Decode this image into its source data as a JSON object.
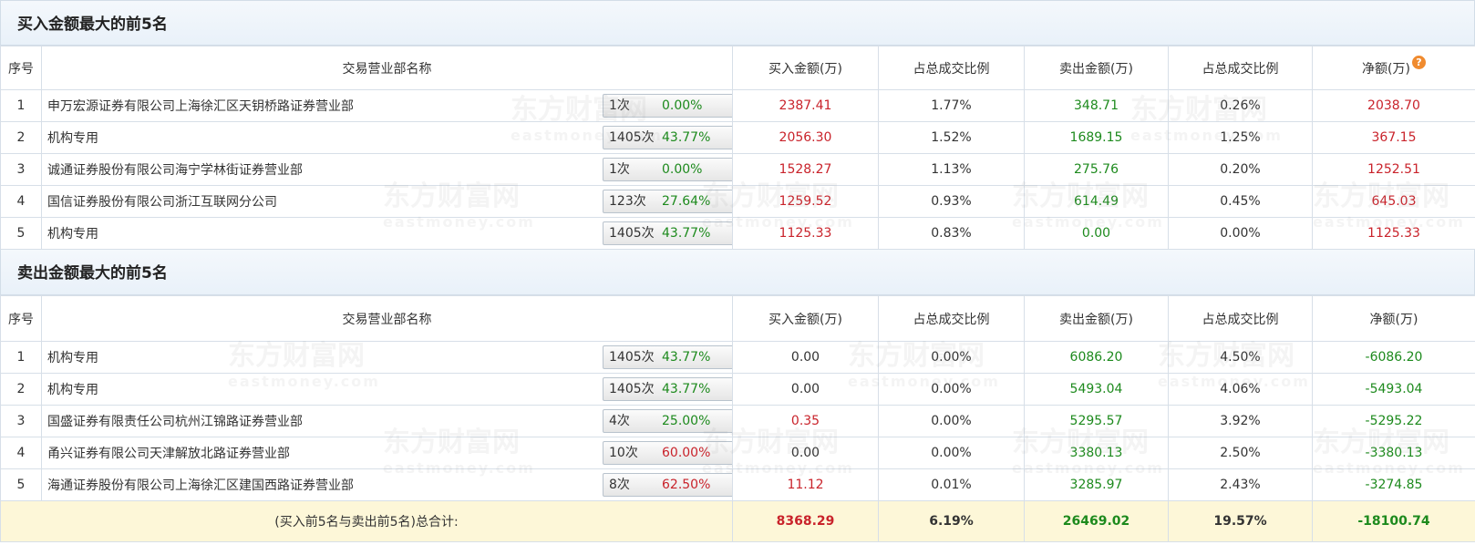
{
  "buy_section": {
    "title": "买入金额最大的前5名",
    "headers": [
      "序号",
      "交易营业部名称",
      "买入金额(万)",
      "占总成交比例",
      "卖出金额(万)",
      "占总成交比例",
      "净额(万)"
    ],
    "rows": [
      {
        "idx": "1",
        "name": "申万宏源证券有限公司上海徐汇区天钥桥路证券营业部",
        "count": "1次",
        "pct": "0.00%",
        "pct_color": "green",
        "icon": "question-icon",
        "buy": "2387.41",
        "buy_ratio": "1.77%",
        "sell": "348.71",
        "sell_ratio": "0.26%",
        "net": "2038.70",
        "net_color": "red"
      },
      {
        "idx": "2",
        "name": "机构专用",
        "count": "1405次",
        "pct": "43.77%",
        "pct_color": "green",
        "icon": "play-arrow-icon",
        "buy": "2056.30",
        "buy_ratio": "1.52%",
        "sell": "1689.15",
        "sell_ratio": "1.25%",
        "net": "367.15",
        "net_color": "red"
      },
      {
        "idx": "3",
        "name": "诚通证券股份有限公司海宁学林街证券营业部",
        "count": "1次",
        "pct": "0.00%",
        "pct_color": "green",
        "icon": "play-arrow-icon",
        "buy": "1528.27",
        "buy_ratio": "1.13%",
        "sell": "275.76",
        "sell_ratio": "0.20%",
        "net": "1252.51",
        "net_color": "red"
      },
      {
        "idx": "4",
        "name": "国信证券股份有限公司浙江互联网分公司",
        "count": "123次",
        "pct": "27.64%",
        "pct_color": "green",
        "icon": "play-arrow-icon",
        "buy": "1259.52",
        "buy_ratio": "0.93%",
        "sell": "614.49",
        "sell_ratio": "0.45%",
        "net": "645.03",
        "net_color": "red"
      },
      {
        "idx": "5",
        "name": "机构专用",
        "count": "1405次",
        "pct": "43.77%",
        "pct_color": "green",
        "icon": "play-arrow-icon",
        "buy": "1125.33",
        "buy_ratio": "0.83%",
        "sell": "0.00",
        "sell_ratio": "0.00%",
        "net": "1125.33",
        "net_color": "red"
      }
    ]
  },
  "sell_section": {
    "title": "卖出金额最大的前5名",
    "headers": [
      "序号",
      "交易营业部名称",
      "买入金额(万)",
      "占总成交比例",
      "卖出金额(万)",
      "占总成交比例",
      "净额(万)"
    ],
    "rows": [
      {
        "idx": "1",
        "name": "机构专用",
        "count": "1405次",
        "pct": "43.77%",
        "pct_color": "green",
        "icon": "question-icon",
        "buy": "0.00",
        "buy_color": "black",
        "buy_ratio": "0.00%",
        "sell": "6086.20",
        "sell_ratio": "4.50%",
        "net": "-6086.20",
        "net_color": "green"
      },
      {
        "idx": "2",
        "name": "机构专用",
        "count": "1405次",
        "pct": "43.77%",
        "pct_color": "green",
        "icon": "play-arrow-icon",
        "buy": "0.00",
        "buy_color": "black",
        "buy_ratio": "0.00%",
        "sell": "5493.04",
        "sell_ratio": "4.06%",
        "net": "-5493.04",
        "net_color": "green"
      },
      {
        "idx": "3",
        "name": "国盛证券有限责任公司杭州江锦路证券营业部",
        "count": "4次",
        "pct": "25.00%",
        "pct_color": "green",
        "icon": "play-arrow-icon",
        "buy": "0.35",
        "buy_color": "red",
        "buy_ratio": "0.00%",
        "sell": "5295.57",
        "sell_ratio": "3.92%",
        "net": "-5295.22",
        "net_color": "green"
      },
      {
        "idx": "4",
        "name": "甬兴证券有限公司天津解放北路证券营业部",
        "count": "10次",
        "pct": "60.00%",
        "pct_color": "red",
        "icon": "play-arrow-icon",
        "buy": "0.00",
        "buy_color": "black",
        "buy_ratio": "0.00%",
        "sell": "3380.13",
        "sell_ratio": "2.50%",
        "net": "-3380.13",
        "net_color": "green"
      },
      {
        "idx": "5",
        "name": "海通证券股份有限公司上海徐汇区建国西路证券营业部",
        "count": "8次",
        "pct": "62.50%",
        "pct_color": "red",
        "icon": "play-arrow-icon",
        "buy": "11.12",
        "buy_color": "red",
        "buy_ratio": "0.01%",
        "sell": "3285.97",
        "sell_ratio": "2.43%",
        "net": "-3274.85",
        "net_color": "green"
      }
    ],
    "total": {
      "label": "(买入前5名与卖出前5名)总合计:",
      "buy": "8368.29",
      "buy_ratio": "6.19%",
      "sell": "26469.02",
      "sell_ratio": "19.57%",
      "net": "-18100.74"
    }
  },
  "watermark": {
    "cn": "东方财富网",
    "en": "eastmoney.com"
  },
  "colors": {
    "red": "#c9232b",
    "green": "#1d8a1d",
    "total_bg": "#fdf7d8",
    "header_bg": "#eef4fa"
  }
}
